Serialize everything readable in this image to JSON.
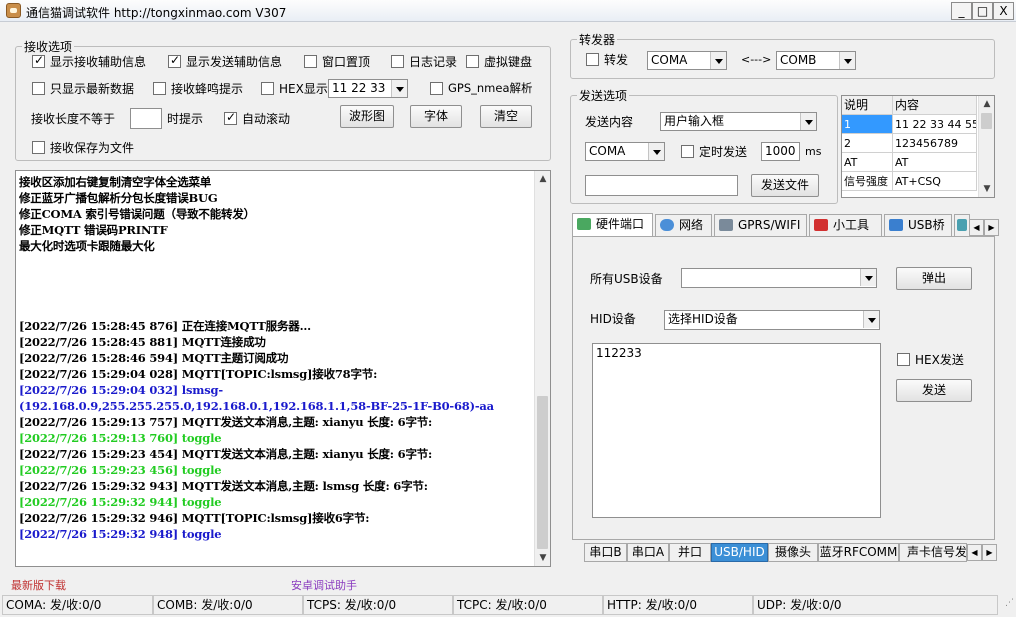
{
  "window": {
    "title": "通信猫调试软件  http://tongxinmao.com  V307",
    "min": "_",
    "max": "□",
    "close": "X"
  },
  "receive_options": {
    "legend": "接收选项",
    "show_recv_aux": "显示接收辅助信息",
    "show_send_aux": "显示发送辅助信息",
    "window_top": "窗口置顶",
    "log_record": "日志记录",
    "virtual_keyboard": "虚拟键盘",
    "only_latest": "只显示最新数据",
    "recv_beep": "接收蜂鸣提示",
    "hex_display": "HEX显示",
    "hex_value": "11 22 33",
    "gps_parse": "GPS_nmea解析",
    "recv_len_label": "接收长度不等于",
    "recv_len_value": "",
    "time_prompt": "时提示",
    "auto_scroll": "自动滚动",
    "waveform": "波形图",
    "font": "字体",
    "clear": "清空",
    "save_file": "接收保存为文件"
  },
  "log": [
    {
      "t": "接收区添加右键复制清空字体全选菜单",
      "c": "#000000"
    },
    {
      "t": "修正蓝牙广播包解析分包长度错误BUG",
      "c": "#000000"
    },
    {
      "t": "修正COMA 索引号错误问题（导致不能转发）",
      "c": "#000000"
    },
    {
      "t": "修正MQTT 错误码PRINTF",
      "c": "#000000"
    },
    {
      "t": "最大化时选项卡跟随最大化",
      "c": "#000000"
    },
    {
      "t": "",
      "c": "#000000"
    },
    {
      "t": "",
      "c": "#000000"
    },
    {
      "t": "",
      "c": "#000000"
    },
    {
      "t": "",
      "c": "#000000"
    },
    {
      "t": "[2022/7/26 15:28:45 876]  正在连接MQTT服务器...",
      "c": "#000000"
    },
    {
      "t": "[2022/7/26 15:28:45 881]  MQTT连接成功",
      "c": "#000000"
    },
    {
      "t": "[2022/7/26 15:28:46 594]  MQTT主题订阅成功",
      "c": "#000000"
    },
    {
      "t": "[2022/7/26 15:29:04 028]  MQTT[TOPIC:lsmsg]接收78字节:",
      "c": "#000000"
    },
    {
      "t": "[2022/7/26 15:29:04 032]  lsmsg-",
      "c": "#1a1acc"
    },
    {
      "t": "(192.168.0.9,255.255.255.0,192.168.0.1,192.168.1.1,58-BF-25-1F-B0-68)-aa",
      "c": "#1a1acc"
    },
    {
      "t": "[2022/7/26 15:29:13 757]  MQTT发送文本消息,主题: xianyu 长度: 6字节:",
      "c": "#000000"
    },
    {
      "t": "[2022/7/26 15:29:13 760]  toggle",
      "c": "#22cc22"
    },
    {
      "t": "[2022/7/26 15:29:23 454]  MQTT发送文本消息,主题: xianyu 长度: 6字节:",
      "c": "#000000"
    },
    {
      "t": "[2022/7/26 15:29:23 456]  toggle",
      "c": "#22cc22"
    },
    {
      "t": "[2022/7/26 15:29:32 943]  MQTT发送文本消息,主题: lsmsg 长度: 6字节:",
      "c": "#000000"
    },
    {
      "t": "[2022/7/26 15:29:32 944]  toggle",
      "c": "#22cc22"
    },
    {
      "t": "[2022/7/26 15:29:32 946]  MQTT[TOPIC:lsmsg]接收6字节:",
      "c": "#000000"
    },
    {
      "t": "[2022/7/26 15:29:32 948]  toggle",
      "c": "#1a1acc"
    }
  ],
  "forwarder": {
    "legend": "转发器",
    "forward": "转发",
    "from": "COMA",
    "arrow": "<--->",
    "to": "COMB"
  },
  "send_options": {
    "legend": "发送选项",
    "content_label": "发送内容",
    "content_value": "用户输入框",
    "port": "COMA",
    "timed_send": "定时发送",
    "interval": "1000",
    "ms": "ms",
    "file_path": "",
    "send_file": "发送文件"
  },
  "grid": {
    "headers": [
      "说明",
      "内容"
    ],
    "rows": [
      [
        "1",
        "11 22 33 44 55"
      ],
      [
        "2",
        "123456789"
      ],
      [
        "AT",
        "AT"
      ],
      [
        "信号强度",
        "AT+CSQ"
      ]
    ]
  },
  "tabs": [
    "硬件端口",
    "网络",
    "GPRS/WIFI",
    "小工具",
    "USB桥",
    "·"
  ],
  "usb": {
    "all_usb_label": "所有USB设备",
    "all_usb_value": "",
    "eject": "弹出",
    "hid_label": "HID设备",
    "hid_value": "选择HID设备",
    "send_text": "112233",
    "hex_send": "HEX发送",
    "send": "发送"
  },
  "bottom_tabs": [
    "串口B",
    "串口A",
    "并口",
    "USB/HID",
    "摄像头",
    "蓝牙RFCOMM",
    "声卡信号发"
  ],
  "links": {
    "download": "最新版下载",
    "android": "安卓调试助手"
  },
  "status": [
    "COMA: 发/收:0/0",
    "COMB: 发/收:0/0",
    "TCPS: 发/收:0/0",
    "TCPC: 发/收:0/0",
    "HTTP: 发/收:0/0",
    "UDP: 发/收:0/0"
  ],
  "colors": {
    "accent": "#3b8fd6",
    "selected": "#3399ff",
    "link": "#c03030",
    "link2": "#8a3bbf"
  }
}
